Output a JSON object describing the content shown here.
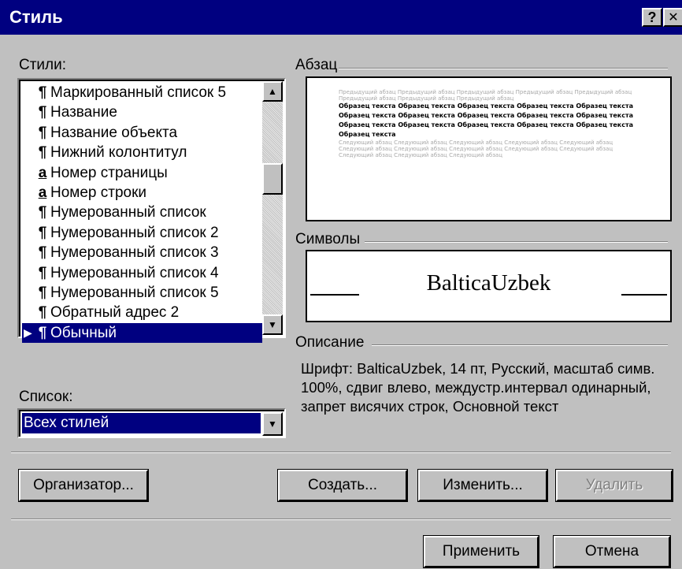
{
  "window": {
    "title": "Стиль",
    "help_button": "?",
    "close_button": "✕"
  },
  "styles_label": "Стили:",
  "styles": [
    {
      "marker": "¶",
      "name": "Маркированный список 5",
      "selected": false
    },
    {
      "marker": "¶",
      "name": "Название",
      "selected": false
    },
    {
      "marker": "¶",
      "name": "Название объекта",
      "selected": false
    },
    {
      "marker": "¶",
      "name": "Нижний колонтитул",
      "selected": false
    },
    {
      "marker": "a",
      "name": "Номер страницы",
      "selected": false
    },
    {
      "marker": "a",
      "name": "Номер строки",
      "selected": false
    },
    {
      "marker": "¶",
      "name": "Нумерованный список",
      "selected": false
    },
    {
      "marker": "¶",
      "name": "Нумерованный список 2",
      "selected": false
    },
    {
      "marker": "¶",
      "name": "Нумерованный список 3",
      "selected": false
    },
    {
      "marker": "¶",
      "name": "Нумерованный список 4",
      "selected": false
    },
    {
      "marker": "¶",
      "name": "Нумерованный список 5",
      "selected": false
    },
    {
      "marker": "¶",
      "name": "Обратный адрес 2",
      "selected": false
    },
    {
      "marker": "¶",
      "name": "Обычный",
      "selected": true
    }
  ],
  "list_label": "Список:",
  "list_value": "Всех стилей",
  "paragraph_label": "Абзац",
  "paragraph_preview": {
    "before": "Предыдущий абзац Предыдущий абзац Предыдущий абзац Предыдущий абзац Предыдущий абзац Предыдущий абзац Предыдущий абзац Предыдущий абзац",
    "sample": "Образец текста Образец текста Образец текста Образец текста Образец текста Образец текста Образец текста Образец текста Образец текста Образец текста Образец текста Образец текста Образец текста Образец текста Образец текста Образец текста",
    "after": "Следующий абзац Следующий абзац Следующий абзац Следующий абзац Следующий абзац Следующий абзац Следующий абзац Следующий абзац Следующий абзац Следующий абзац Следующий абзац Следующий абзац Следующий абзац"
  },
  "symbols_label": "Символы",
  "symbols_sample": "BalticaUzbek",
  "description_label": "Описание",
  "description": "Шрифт: BalticaUzbek, 14 пт, Русский, масштаб симв. 100%, сдвиг влево, междустр.интервал одинарный, запрет висячих строк, Основной текст",
  "buttons": {
    "organizer": "Организатор...",
    "create": "Создать...",
    "modify": "Изменить...",
    "delete": "Удалить",
    "apply": "Применить",
    "cancel": "Отмена"
  },
  "colors": {
    "titlebar": "#000080",
    "dialog": "#c0c0c0",
    "selection": "#000080"
  }
}
